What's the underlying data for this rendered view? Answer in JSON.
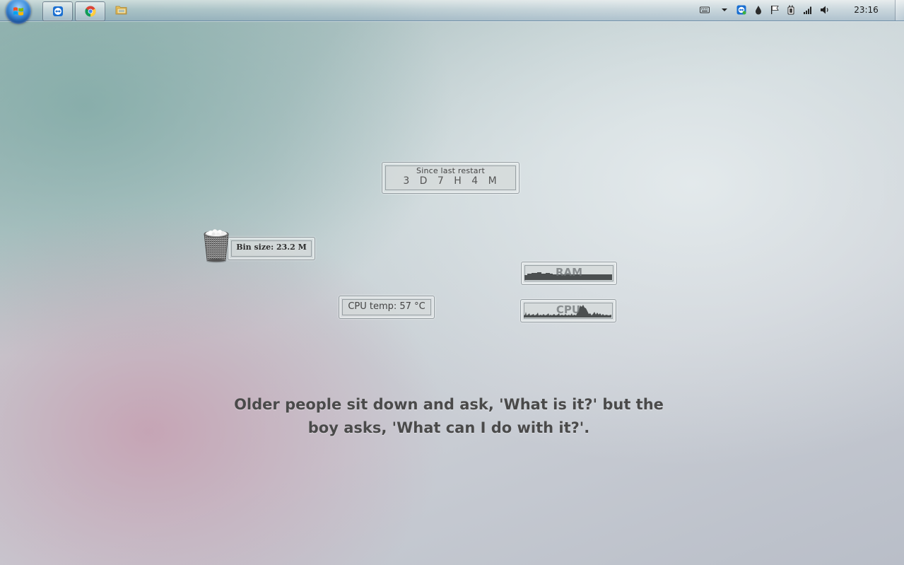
{
  "taskbar": {
    "start_button": "windows-start-icon",
    "pinned": [
      {
        "name": "teamviewer",
        "icon": "teamviewer-icon"
      },
      {
        "name": "chrome",
        "icon": "chrome-icon"
      },
      {
        "name": "file-explorer",
        "icon": "folder-icon"
      }
    ],
    "tray": {
      "icons": [
        "keyboard-icon",
        "chevron-down-icon",
        "teamviewer-icon",
        "drop-icon",
        "flag-icon",
        "power-icon",
        "signal-icon",
        "volume-icon"
      ],
      "clock": "23:16"
    }
  },
  "widgets": {
    "uptime": {
      "label": "Since last restart",
      "value": "3 D   7 H   4 M"
    },
    "recycle_bin": {
      "label": "Bin size: 23.2 M",
      "icon": "recycle-bin-icon"
    },
    "cpu_temp": {
      "label": "CPU temp: 57 °C"
    },
    "ram_graph": {
      "label": "RAM"
    },
    "cpu_graph": {
      "label": "CPU"
    }
  },
  "quote": {
    "line1": "Older people sit down and ask, 'What is it?' but the",
    "line2": "boy asks, 'What can I do with it?'."
  },
  "colors": {
    "taskbar_border": "#6f8fa8",
    "text_dark": "#4a4a4a",
    "graph_fill": "#4b4f50"
  }
}
